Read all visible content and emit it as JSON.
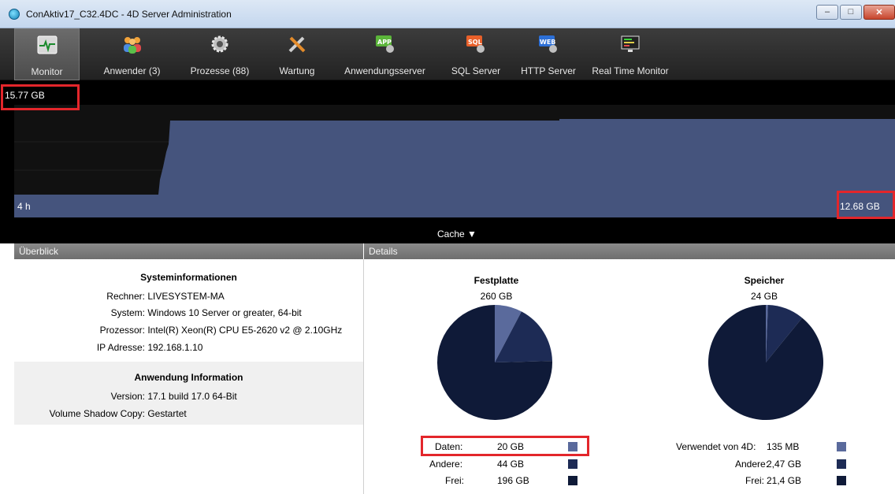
{
  "window": {
    "title": "ConAktiv17_C32.4DC - 4D Server Administration"
  },
  "toolbar": {
    "items": [
      {
        "label": "Monitor",
        "icon": "monitor-icon",
        "active": true
      },
      {
        "label": "Anwender (3)",
        "icon": "users-icon"
      },
      {
        "label": "Prozesse (88)",
        "icon": "gear-icon"
      },
      {
        "label": "Wartung",
        "icon": "tools-icon"
      },
      {
        "label": "Anwendungsserver",
        "icon": "app-server-icon"
      },
      {
        "label": "SQL Server",
        "icon": "sql-server-icon"
      },
      {
        "label": "HTTP Server",
        "icon": "http-server-icon"
      },
      {
        "label": "Real Time Monitor",
        "icon": "real-time-monitor-icon"
      }
    ]
  },
  "graph": {
    "max_label": "15.77 GB",
    "time_label": "4 h",
    "current_label": "12.68 GB",
    "selector_label": "Cache",
    "fill_color": "#45547d"
  },
  "overview": {
    "title": "Überblick",
    "system": {
      "title": "Systeminformationen",
      "rows": [
        {
          "key": "Rechner:",
          "value": "LIVESYSTEM-MA"
        },
        {
          "key": "System:",
          "value": "Windows 10 Server or greater, 64-bit"
        },
        {
          "key": "Prozessor:",
          "value": "Intel(R) Xeon(R) CPU E5-2620 v2 @ 2.10GHz"
        },
        {
          "key": "IP Adresse:",
          "value": "192.168.1.10"
        }
      ]
    },
    "application": {
      "title": "Anwendung Information",
      "rows": [
        {
          "key": "Version:",
          "value": "17.1 build 17.0 64-Bit"
        },
        {
          "key": "Volume Shadow Copy:",
          "value": "Gestartet"
        }
      ]
    }
  },
  "details": {
    "title": "Details",
    "disk": {
      "title": "Festplatte",
      "total": "260 GB",
      "legend": [
        {
          "label": "Daten:",
          "value": "20 GB",
          "color": "#5a6a9c",
          "fraction": 0.077
        },
        {
          "label": "Andere:",
          "value": "44 GB",
          "color": "#1d2b55",
          "fraction": 0.169
        },
        {
          "label": "Frei:",
          "value": "196 GB",
          "color": "#0f1a38",
          "fraction": 0.754
        }
      ]
    },
    "memory": {
      "title": "Speicher",
      "total": "24 GB",
      "legend": [
        {
          "label": "Verwendet von 4D:",
          "value": "135 MB",
          "color": "#5a6a9c",
          "fraction": 0.006
        },
        {
          "label": "Andere:",
          "value": "2,47 GB",
          "color": "#1d2b55",
          "fraction": 0.103
        },
        {
          "label": "Frei:",
          "value": "21,4 GB",
          "color": "#0f1a38",
          "fraction": 0.891
        }
      ]
    }
  }
}
